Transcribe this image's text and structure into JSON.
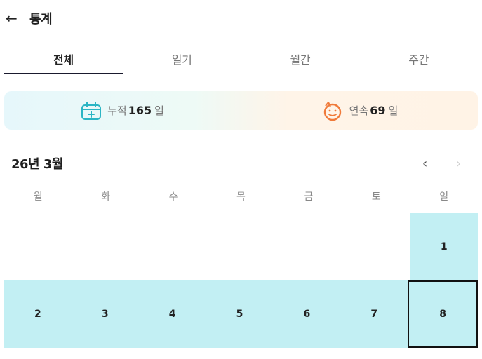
{
  "header": {
    "back_icon": "arrow-left-icon",
    "back_glyph": "←",
    "title": "통계"
  },
  "tabs": [
    {
      "label": "전체",
      "active": true
    },
    {
      "label": "일기",
      "active": false
    },
    {
      "label": "월간",
      "active": false
    },
    {
      "label": "주간",
      "active": false
    }
  ],
  "summary": {
    "total": {
      "icon": "calendar-plus-icon",
      "label": "누적",
      "value": "165",
      "unit": "일"
    },
    "streak": {
      "icon": "smiley-face-icon",
      "label": "연속",
      "value": "69",
      "unit": "일"
    }
  },
  "calendar": {
    "month_label": "26년 3월",
    "prev_icon": "chevron-left-icon",
    "prev_glyph": "‹",
    "next_icon": "chevron-right-icon",
    "next_glyph": "›",
    "weekdays": [
      "월",
      "화",
      "수",
      "목",
      "금",
      "토",
      "일"
    ],
    "weeks": [
      [
        {
          "day": "",
          "filled": false,
          "today": false
        },
        {
          "day": "",
          "filled": false,
          "today": false
        },
        {
          "day": "",
          "filled": false,
          "today": false
        },
        {
          "day": "",
          "filled": false,
          "today": false
        },
        {
          "day": "",
          "filled": false,
          "today": false
        },
        {
          "day": "",
          "filled": false,
          "today": false
        },
        {
          "day": "1",
          "filled": true,
          "today": false
        }
      ],
      [
        {
          "day": "2",
          "filled": true,
          "today": false
        },
        {
          "day": "3",
          "filled": true,
          "today": false
        },
        {
          "day": "4",
          "filled": true,
          "today": false
        },
        {
          "day": "5",
          "filled": true,
          "today": false
        },
        {
          "day": "6",
          "filled": true,
          "today": false
        },
        {
          "day": "7",
          "filled": true,
          "today": false
        },
        {
          "day": "8",
          "filled": true,
          "today": true
        }
      ]
    ]
  },
  "colors": {
    "filled": "#c2eff3",
    "accent": "#1a1a2e",
    "streak_icon": "#f07a3a",
    "total_icon": "#2bb5c4"
  }
}
